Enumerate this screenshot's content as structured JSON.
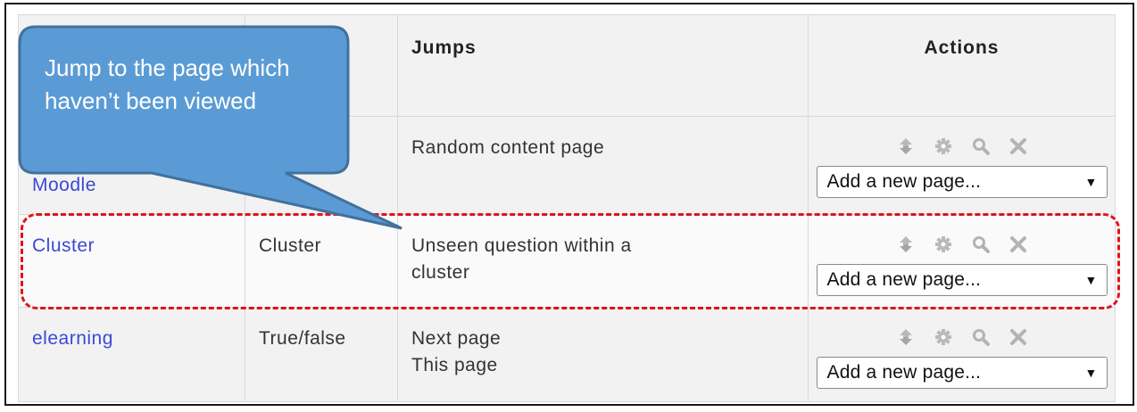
{
  "table": {
    "headers": {
      "page_title": "",
      "page_type": "",
      "jumps": "Jumps",
      "actions": "Actions"
    },
    "rows": [
      {
        "page_title": "Moodle",
        "page_type": "",
        "jumps": [
          "Random content page"
        ],
        "action_select": "Add a new page..."
      },
      {
        "page_title": "Cluster",
        "page_type": "Cluster",
        "jumps": [
          "Unseen question within a",
          "cluster"
        ],
        "action_select": "Add a new page..."
      },
      {
        "page_title": "elearning",
        "page_type": "True/false",
        "jumps": [
          "Next page",
          "This page"
        ],
        "action_select": "Add a new page..."
      }
    ],
    "action_icons": [
      "move-icon",
      "settings-icon",
      "preview-icon",
      "delete-icon"
    ]
  },
  "callout": {
    "text": "Jump to the page which haven’t been viewed"
  },
  "colors": {
    "link": "#3a49d6",
    "callout_fill": "#5b9bd5",
    "callout_border": "#41719c",
    "highlight": "#e0141e"
  }
}
